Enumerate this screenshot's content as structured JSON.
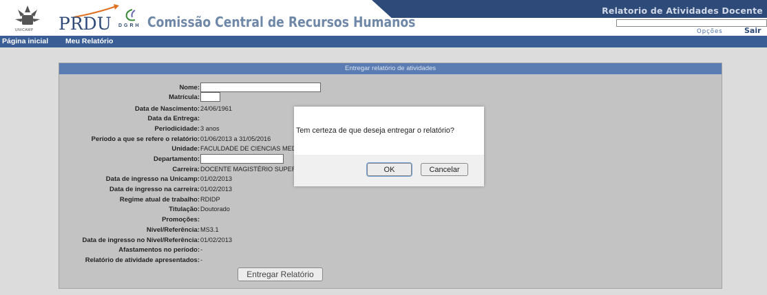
{
  "header": {
    "title": "Relatorio de Atividades Docente",
    "search_value": "",
    "opcoes_label": "Opções",
    "sair_label": "Sair",
    "logo_unicamp_label": "UNICAMP",
    "prdu_label": "PRDU",
    "dgrh_label": "DGRH",
    "comissao_label": "Comissão Central de Recursos Humanos"
  },
  "nav": {
    "items": [
      {
        "label": "Página inicial"
      },
      {
        "label": "Meu Relatório"
      }
    ]
  },
  "panel": {
    "title": "Entregar relatório de atividades",
    "fields": [
      {
        "label": "Nome:",
        "value": ""
      },
      {
        "label": "Matrícula:",
        "value": ""
      },
      {
        "label": "Data de Nascimento:",
        "value": "24/06/1961"
      },
      {
        "label": "Data da Entrega:",
        "value": ""
      },
      {
        "label": "Periodicidade:",
        "value": "3 anos"
      },
      {
        "label": "Período a que se refere o relatório:",
        "value": "01/06/2013 a 31/05/2016"
      },
      {
        "label": "Unidade:",
        "value": "FACULDADE DE CIENCIAS MED"
      },
      {
        "label": "Departamento:",
        "value": ""
      },
      {
        "label": "Carreira:",
        "value": "DOCENTE MAGISTÉRIO SUPER"
      },
      {
        "label": "Data de ingresso na Unicamp:",
        "value": "01/02/2013"
      },
      {
        "label": "Data de ingresso na carreira:",
        "value": "01/02/2013"
      },
      {
        "label": "Regime atual de trabalho:",
        "value": "RDIDP"
      },
      {
        "label": "Titulação:",
        "value": "Doutorado"
      },
      {
        "label": "Promoções:",
        "value": ""
      },
      {
        "label": "Nível/Referência:",
        "value": "MS3.1"
      },
      {
        "label": "Data de ingresso no Nível/Referência:",
        "value": "01/02/2013"
      },
      {
        "label": "Afastamentos no período:",
        "value": "-"
      },
      {
        "label": "Relatório de atividade apresentados:",
        "value": "-"
      }
    ],
    "submit_label": "Entregar Relatório"
  },
  "modal": {
    "message": "Tem certeza de que deseja entregar o relatório?",
    "ok_label": "OK",
    "cancel_label": "Cancelar"
  },
  "colors": {
    "header_band": "#2d4a78",
    "navbar": "#3a5d96",
    "panel_title": "#5a7cb2",
    "panel_bg": "#c3c3c3"
  }
}
